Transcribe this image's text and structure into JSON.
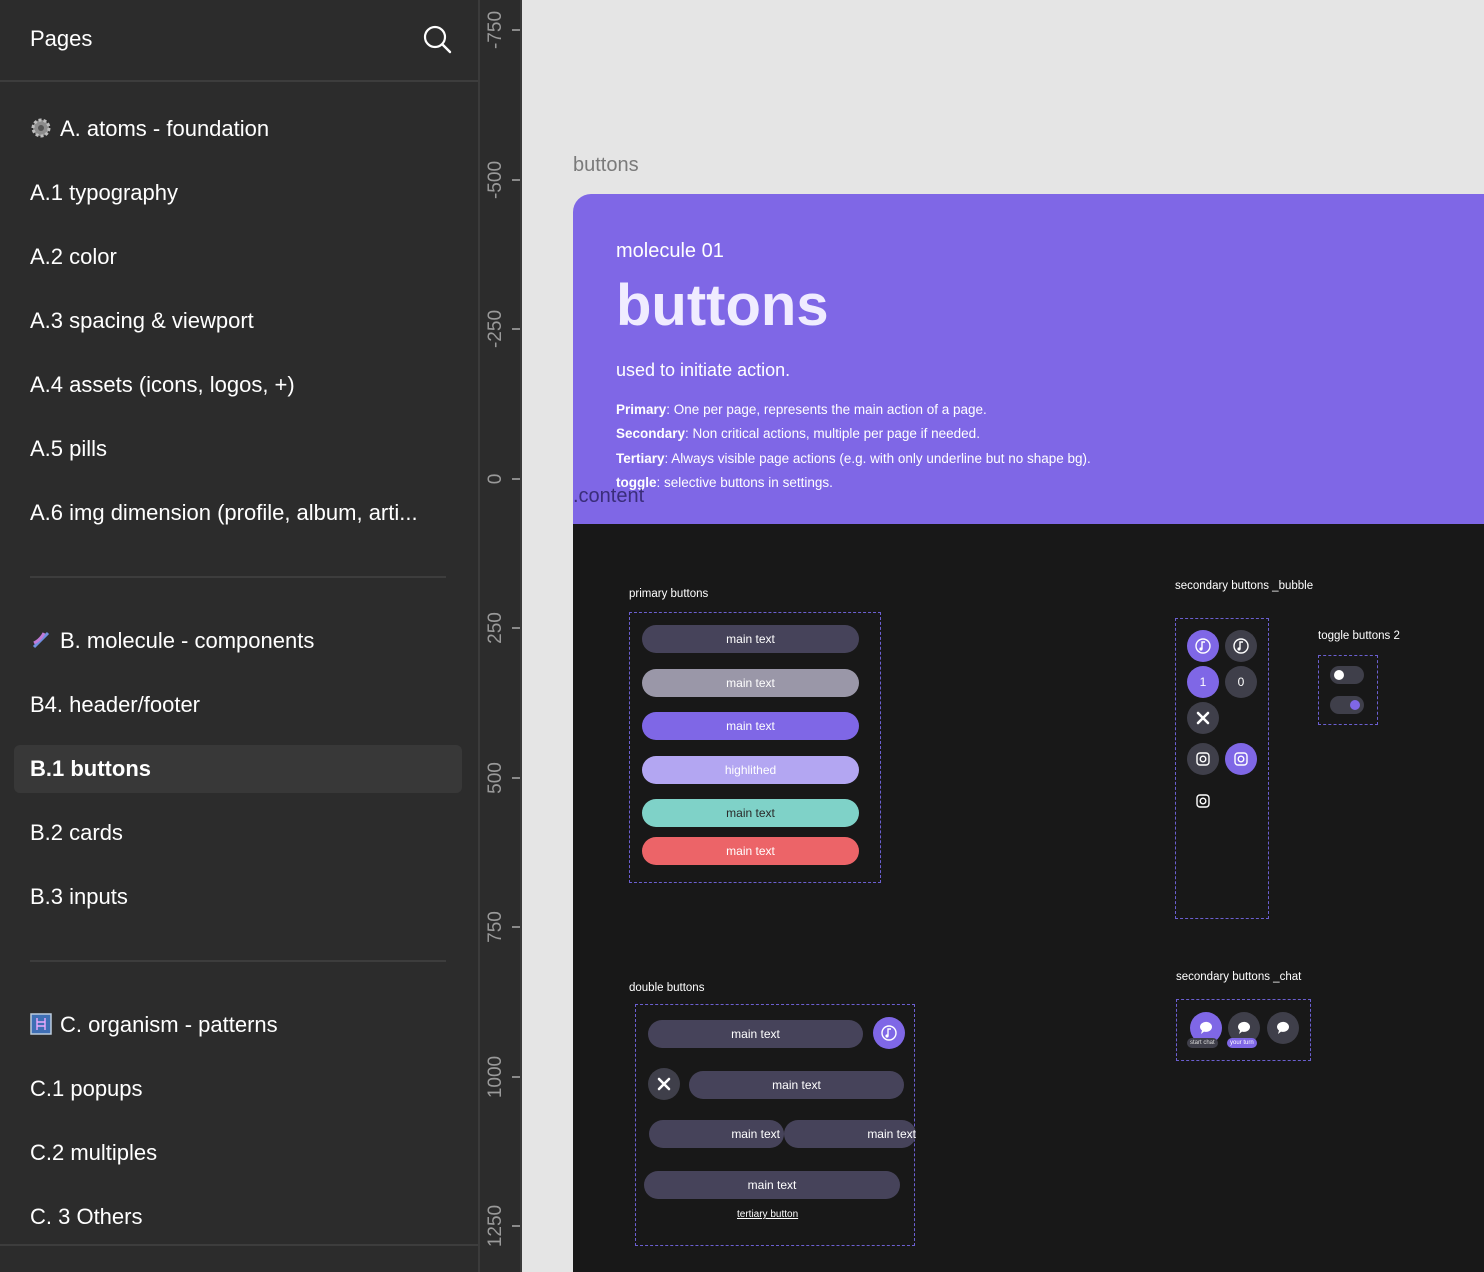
{
  "sidebar": {
    "title": "Pages",
    "items": [
      {
        "label": "A. atoms - foundation",
        "emoji": "gear-emoji-icon"
      },
      {
        "label": "A.1 typography"
      },
      {
        "label": "A.2 color"
      },
      {
        "label": "A.3 spacing & viewport"
      },
      {
        "label": "A.4 assets (icons, logos, +)"
      },
      {
        "label": "A.5 pills"
      },
      {
        "label": "A.6 img dimension (profile, album, arti..."
      },
      {
        "label": "B. molecule - components",
        "emoji": "dna-emoji-icon"
      },
      {
        "label": "B4. header/footer"
      },
      {
        "label": "B.1 buttons",
        "selected": true
      },
      {
        "label": "B.2 cards"
      },
      {
        "label": "B.3 inputs"
      },
      {
        "label": "C. organism - patterns",
        "emoji": "xray-emoji-icon"
      },
      {
        "label": "C.1 popups"
      },
      {
        "label": "C.2 multiples"
      },
      {
        "label": "C. 3 Others"
      }
    ]
  },
  "ruler": [
    "-750",
    "-500",
    "-250",
    "0",
    "250",
    "500",
    "750",
    "1000",
    "1250"
  ],
  "canvas": {
    "frame_label": "buttons",
    "hero": {
      "eyebrow": "molecule 01",
      "title": "buttons",
      "subtitle": "used to initiate action.",
      "desc": [
        {
          "term": "Primary",
          "text": ": One per page, represents the main action of a page."
        },
        {
          "term": "Secondary",
          "text": ": Non critical actions, multiple per page if needed."
        },
        {
          "term": "Tertiary",
          "text": ": Always visible page actions (e.g. with only underline but no shape bg)."
        },
        {
          "term": "toggle",
          "text": ": selective buttons in settings."
        }
      ],
      "content_label": ".content"
    },
    "primary": {
      "title": "primary buttons",
      "buttons": [
        {
          "label": "main text",
          "color": "#46435a"
        },
        {
          "label": "main text",
          "color": "#9a97a8"
        },
        {
          "label": "main text",
          "color": "#7f67e6"
        },
        {
          "label": "highlithed",
          "color": "#b3a6f2"
        },
        {
          "label": "main text",
          "color": "#7fd2c8"
        },
        {
          "label": "main text",
          "color": "#ec6468"
        }
      ]
    },
    "secondary_bubble": {
      "title": "secondary buttons _bubble",
      "count_active": "1",
      "count_inactive": "0"
    },
    "toggle": {
      "title": "toggle buttons 2"
    },
    "secondary_chat": {
      "title": "secondary buttons _chat",
      "start_label": "start chat",
      "turn_label": "your turn"
    },
    "double": {
      "title": "double buttons",
      "row1": "main text",
      "row2": "main text",
      "row3_left": "main text",
      "row3_right": "main text",
      "row4": "main text",
      "tertiary": "tertiary button"
    }
  },
  "colors": {
    "accent": "#7f67e6",
    "dark_pill": "#46435a",
    "teal": "#7fd2c8",
    "red": "#ec6468"
  }
}
